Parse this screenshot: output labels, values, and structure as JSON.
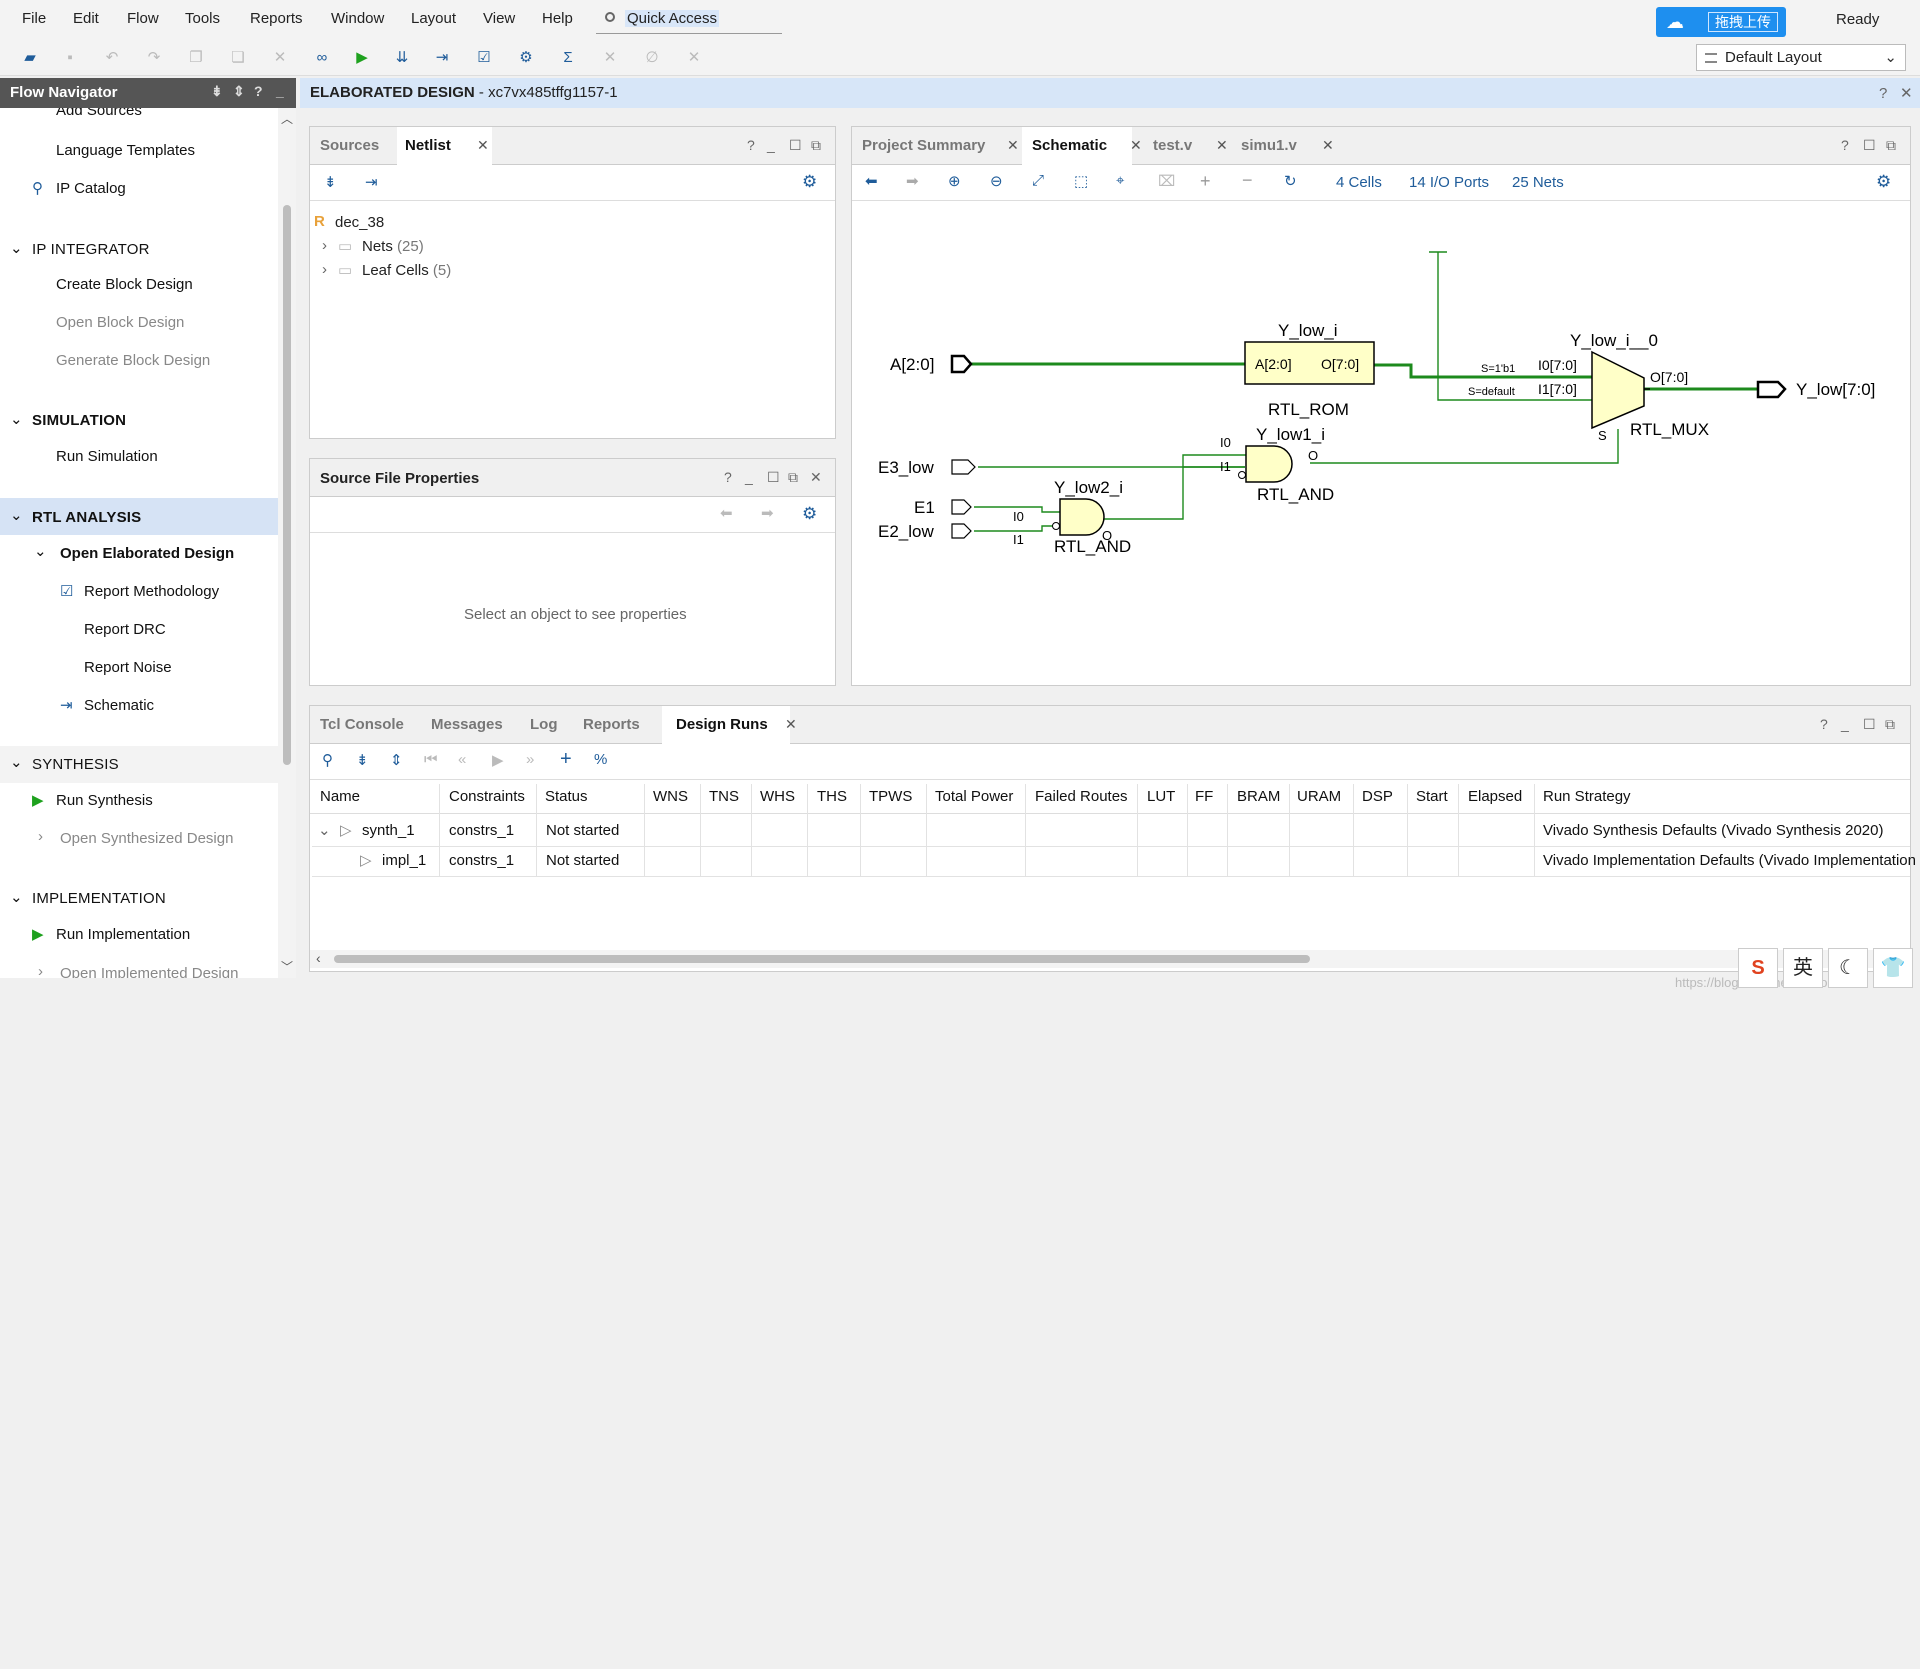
{
  "menubar": {
    "items": [
      "File",
      "Edit",
      "Flow",
      "Tools",
      "Reports",
      "Window",
      "Layout",
      "View",
      "Help"
    ],
    "quick_access": "Quick Access",
    "upload_label": "拖拽上传",
    "status": "Ready"
  },
  "toolbar": {
    "layout_select": "Default Layout"
  },
  "flow_navigator": {
    "title": "Flow Navigator",
    "items": {
      "add_sources": "Add Sources",
      "language_templates": "Language Templates",
      "ip_catalog": "IP Catalog",
      "ip_integrator": "IP INTEGRATOR",
      "create_block_design": "Create Block Design",
      "open_block_design": "Open Block Design",
      "generate_block_design": "Generate Block Design",
      "simulation": "SIMULATION",
      "run_simulation": "Run Simulation",
      "rtl_analysis": "RTL ANALYSIS",
      "open_elaborated_design": "Open Elaborated Design",
      "report_methodology": "Report Methodology",
      "report_drc": "Report DRC",
      "report_noise": "Report Noise",
      "schematic": "Schematic",
      "synthesis": "SYNTHESIS",
      "run_synthesis": "Run Synthesis",
      "open_synthesized_design": "Open Synthesized Design",
      "implementation": "IMPLEMENTATION",
      "run_implementation": "Run Implementation",
      "open_implemented_design": "Open Implemented Design"
    }
  },
  "elaborated": {
    "title": "ELABORATED DESIGN",
    "part": " - xc7vx485tffg1157-1"
  },
  "netlist_panel": {
    "tabs": [
      "Sources",
      "Netlist"
    ],
    "root": "dec_38",
    "nets_label": "Nets",
    "nets_count": "(25)",
    "leaf_label": "Leaf Cells",
    "leaf_count": "(5)"
  },
  "props_panel": {
    "title": "Source File Properties",
    "empty_msg": "Select an object to see properties"
  },
  "schematic_panel": {
    "tabs": [
      "Project Summary",
      "Schematic",
      "test.v",
      "simu1.v"
    ],
    "cells": "4 Cells",
    "ports": "14 I/O Ports",
    "nets": "25 Nets",
    "labels": {
      "a_in": "A[2:0]",
      "e3": "E3_low",
      "e1": "E1",
      "e2": "E2_low",
      "y_out": "Y_low[7:0]",
      "rom_inst": "Y_low_i",
      "rom_in": "A[2:0]",
      "rom_out": "O[7:0]",
      "rom_type": "RTL_ROM",
      "mux_inst": "Y_low_i__0",
      "mux_i0": "I0[7:0]",
      "mux_i1": "I1[7:0]",
      "mux_s1": "S=1'b1",
      "mux_sdef": "S=default",
      "mux_out": "O[7:0]",
      "mux_s": "S",
      "mux_type": "RTL_MUX",
      "and1_inst": "Y_low1_i",
      "and1_i0": "I0",
      "and1_i1": "I1",
      "and1_o": "O",
      "and1_type": "RTL_AND",
      "and2_inst": "Y_low2_i",
      "and2_i0": "I0",
      "and2_i1": "I1",
      "and2_o": "O",
      "and2_type": "RTL_AND"
    }
  },
  "runs_panel": {
    "tabs": [
      "Tcl Console",
      "Messages",
      "Log",
      "Reports",
      "Design Runs"
    ],
    "columns": [
      "Name",
      "Constraints",
      "Status",
      "WNS",
      "TNS",
      "WHS",
      "THS",
      "TPWS",
      "Total Power",
      "Failed Routes",
      "LUT",
      "FF",
      "BRAM",
      "URAM",
      "DSP",
      "Start",
      "Elapsed",
      "Run Strategy"
    ],
    "rows": [
      {
        "name": "synth_1",
        "constraints": "constrs_1",
        "status": "Not started",
        "strategy": "Vivado Synthesis Defaults (Vivado Synthesis 2020)"
      },
      {
        "name": "impl_1",
        "constraints": "constrs_1",
        "status": "Not started",
        "strategy": "Vivado Implementation Defaults (Vivado Implementation"
      }
    ]
  },
  "ime": {
    "lang": "英"
  },
  "watermark": "https://blog.csdn.net/cobrome"
}
